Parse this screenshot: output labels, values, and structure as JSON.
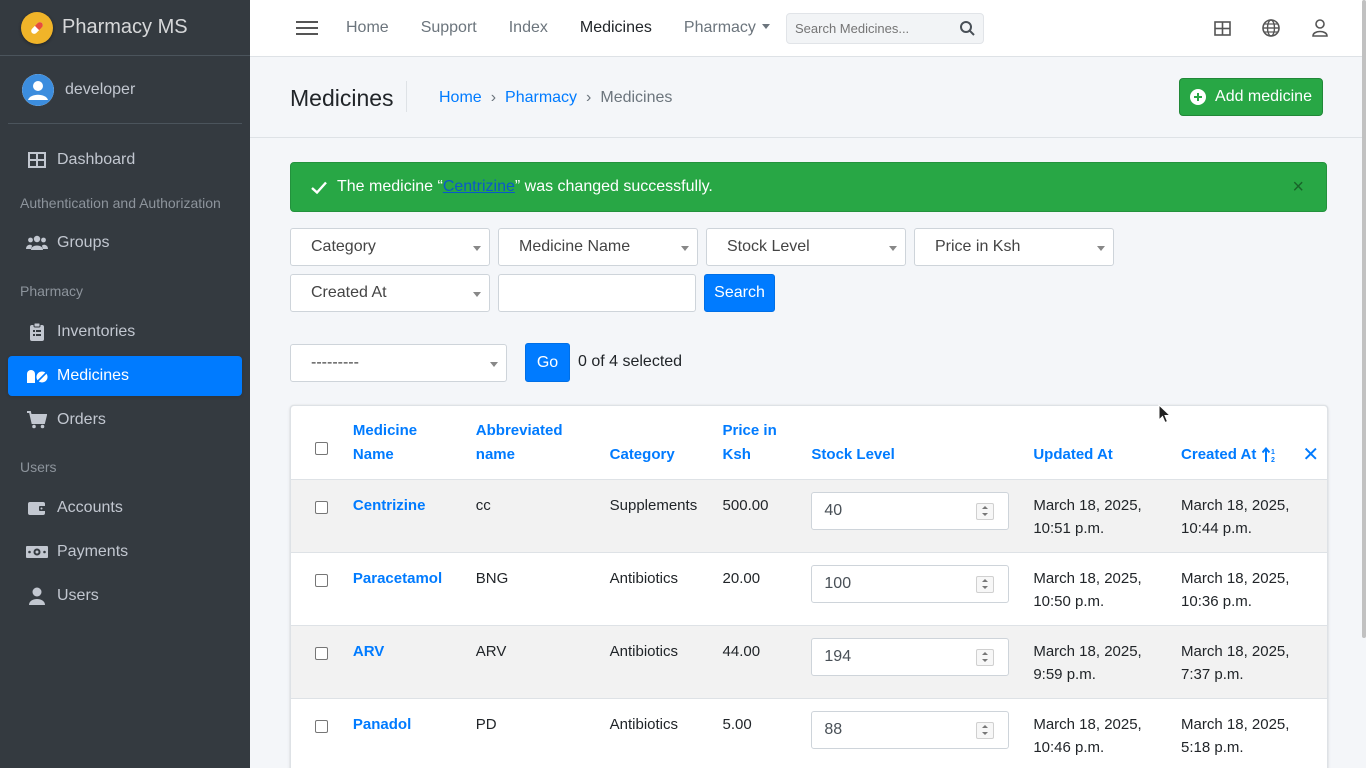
{
  "brand": {
    "name": "Pharmacy MS"
  },
  "user": {
    "name": "developer"
  },
  "sidebar": {
    "dashboard": "Dashboard",
    "section_auth": "Authentication and Authorization",
    "groups": "Groups",
    "section_pharmacy": "Pharmacy",
    "inventories": "Inventories",
    "medicines": "Medicines",
    "orders": "Orders",
    "section_users": "Users",
    "accounts": "Accounts",
    "payments": "Payments",
    "users": "Users"
  },
  "topnav": {
    "home": "Home",
    "support": "Support",
    "index": "Index",
    "medicines": "Medicines",
    "pharmacy": "Pharmacy",
    "search_placeholder": "Search Medicines..."
  },
  "header": {
    "title": "Medicines",
    "breadcrumb": {
      "home": "Home",
      "sep": "›",
      "pharmacy": "Pharmacy",
      "current": "Medicines"
    },
    "add_button": "Add medicine"
  },
  "alert": {
    "prefix": "The medicine “",
    "link": "Centrizine",
    "suffix": "” was changed successfully.",
    "close": "×"
  },
  "filters": {
    "category": "Category",
    "medicine_name": "Medicine Name",
    "stock_level": "Stock Level",
    "price": "Price in Ksh",
    "created_at": "Created At",
    "search_value": "",
    "search_button": "Search"
  },
  "actions": {
    "select_value": "---------",
    "go_button": "Go",
    "selected_count": "0 of 4 selected"
  },
  "table": {
    "headers": {
      "name_l1": "Medicine",
      "name_l2": "Name",
      "abbr_l1": "Abbreviated",
      "abbr_l2": "name",
      "category": "Category",
      "price_l1": "Price in",
      "price_l2": "Ksh",
      "stock": "Stock Level",
      "updated": "Updated At",
      "created": "Created At"
    },
    "rows": [
      {
        "name": "Centrizine",
        "abbr": "cc",
        "category": "Supplements",
        "price": "500.00",
        "stock": "40",
        "updated_1": "March 18, 2025,",
        "updated_2": "10:51 p.m.",
        "created_1": "March 18, 2025,",
        "created_2": "10:44 p.m."
      },
      {
        "name": "Paracetamol",
        "abbr": "BNG",
        "category": "Antibiotics",
        "price": "20.00",
        "stock": "100",
        "updated_1": "March 18, 2025,",
        "updated_2": "10:50 p.m.",
        "created_1": "March 18, 2025,",
        "created_2": "10:36 p.m."
      },
      {
        "name": "ARV",
        "abbr": "ARV",
        "category": "Antibiotics",
        "price": "44.00",
        "stock": "194",
        "updated_1": "March 18, 2025,",
        "updated_2": "9:59 p.m.",
        "created_1": "March 18, 2025,",
        "created_2": "7:37 p.m."
      },
      {
        "name": "Panadol",
        "abbr": "PD",
        "category": "Antibiotics",
        "price": "5.00",
        "stock": "88",
        "updated_1": "March 18, 2025,",
        "updated_2": "10:46 p.m.",
        "created_1": "March 18, 2025,",
        "created_2": "5:18 p.m."
      }
    ]
  },
  "colors": {
    "sidebar_bg": "#343a40",
    "primary": "#007bff",
    "success": "#28a745"
  }
}
